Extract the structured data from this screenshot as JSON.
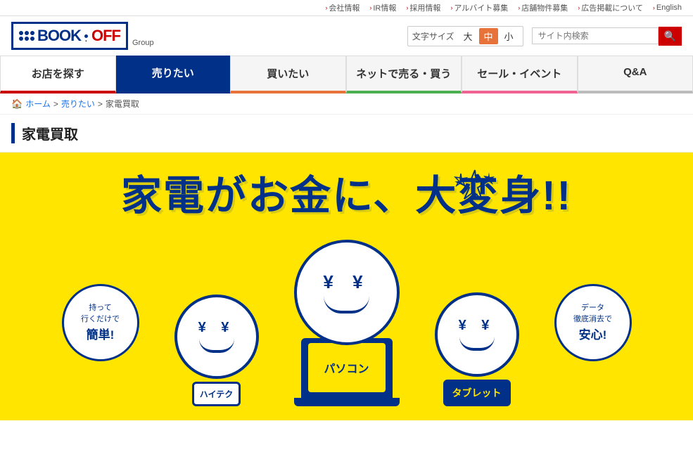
{
  "topnav": {
    "items": [
      {
        "label": "会社情報",
        "arrow": "›"
      },
      {
        "label": "IR情報",
        "arrow": "›"
      },
      {
        "label": "採用情報",
        "arrow": "›"
      },
      {
        "label": "アルバイト募集",
        "arrow": "›"
      },
      {
        "label": "店舗物件募集",
        "arrow": "›"
      },
      {
        "label": "広告掲載について",
        "arrow": "›"
      },
      {
        "label": "English",
        "arrow": "›"
      }
    ]
  },
  "header": {
    "logo_book": "BOOK",
    "logo_off": "OFF",
    "logo_group": "Group",
    "font_size_label": "文字サイズ",
    "font_large": "大",
    "font_mid": "中",
    "font_small": "小",
    "search_placeholder": "サイト内検索"
  },
  "mainnav": {
    "items": [
      {
        "label": "お店を探す",
        "type": "find"
      },
      {
        "label": "売りたい",
        "type": "active"
      },
      {
        "label": "買いたい",
        "type": "buy-want"
      },
      {
        "label": "ネットで売る・買う",
        "type": "online"
      },
      {
        "label": "セール・イベント",
        "type": "sale"
      },
      {
        "label": "Q&A",
        "type": "qa"
      }
    ]
  },
  "breadcrumb": {
    "home": "ホーム",
    "sep1": ">",
    "sell": "売りたい",
    "sep2": ">",
    "current": "家電買取"
  },
  "page_title": "家電買取",
  "banner": {
    "title_line1": "家電がお金に、大変身!!",
    "left_bubble_lines": [
      "持って",
      "行くだけで",
      "簡単!"
    ],
    "right_bubble_lines": [
      "データ",
      "徹底消去で",
      "安心!"
    ],
    "char_center_label": "パソコン",
    "char_right_label": "タブレット",
    "yen_symbol": "¥ ¥"
  }
}
